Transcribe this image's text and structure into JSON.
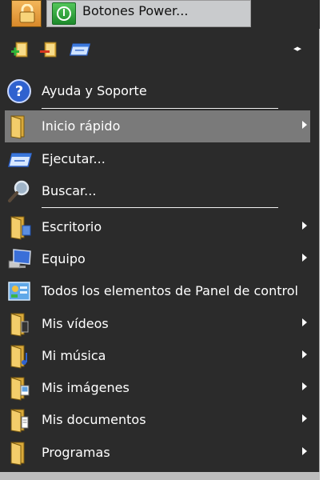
{
  "top": {
    "power_label": "Botones Power..."
  },
  "toolbar": {
    "icons": [
      "add-folder-icon",
      "remove-folder-icon",
      "run-window-icon"
    ],
    "arrows": "◂▸"
  },
  "items": [
    {
      "label": "Ayuda y Soporte",
      "icon": "help-icon"
    },
    {
      "label": "Inicio rápido",
      "icon": "folder-icon",
      "submenu": true,
      "selected": true
    },
    {
      "label": "Ejecutar...",
      "icon": "run-icon"
    },
    {
      "label": "Buscar...",
      "icon": "search-icon"
    },
    {
      "label": "Escritorio",
      "icon": "folder-icon",
      "submenu": true
    },
    {
      "label": "Equipo",
      "icon": "computer-icon",
      "submenu": true
    },
    {
      "label": "Todos los elementos de Panel de control",
      "icon": "control-panel-icon"
    },
    {
      "label": "Mis vídeos",
      "icon": "videos-folder-icon",
      "submenu": true
    },
    {
      "label": "Mi música",
      "icon": "music-folder-icon",
      "submenu": true
    },
    {
      "label": "Mis imágenes",
      "icon": "pictures-folder-icon",
      "submenu": true
    },
    {
      "label": "Mis documentos",
      "icon": "documents-folder-icon",
      "submenu": true
    },
    {
      "label": "Programas",
      "icon": "programs-folder-icon",
      "submenu": true
    }
  ],
  "colors": {
    "menu_bg": "#2b2b2b",
    "selected_bg": "#7a7a7a",
    "text": "#ffffff"
  }
}
